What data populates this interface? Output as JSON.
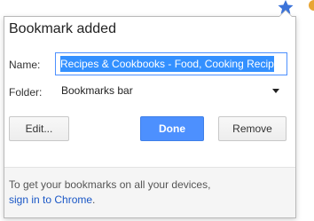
{
  "toolbar": {
    "star_icon": "star-icon",
    "extension_icon": "extension-icon"
  },
  "bubble": {
    "title": "Bookmark added",
    "name_label": "Name:",
    "name_value": "Recipes & Cookbooks - Food, Cooking Recip",
    "folder_label": "Folder:",
    "folder_value": "Bookmarks bar",
    "edit_label": "Edit...",
    "done_label": "Done",
    "remove_label": "Remove",
    "footer_text": "To get your bookmarks on all your devices,",
    "footer_link": "sign in to Chrome",
    "footer_period": "."
  },
  "colors": {
    "accent": "#4d90fe",
    "star": "#3b73d9",
    "link": "#1a57c6"
  }
}
